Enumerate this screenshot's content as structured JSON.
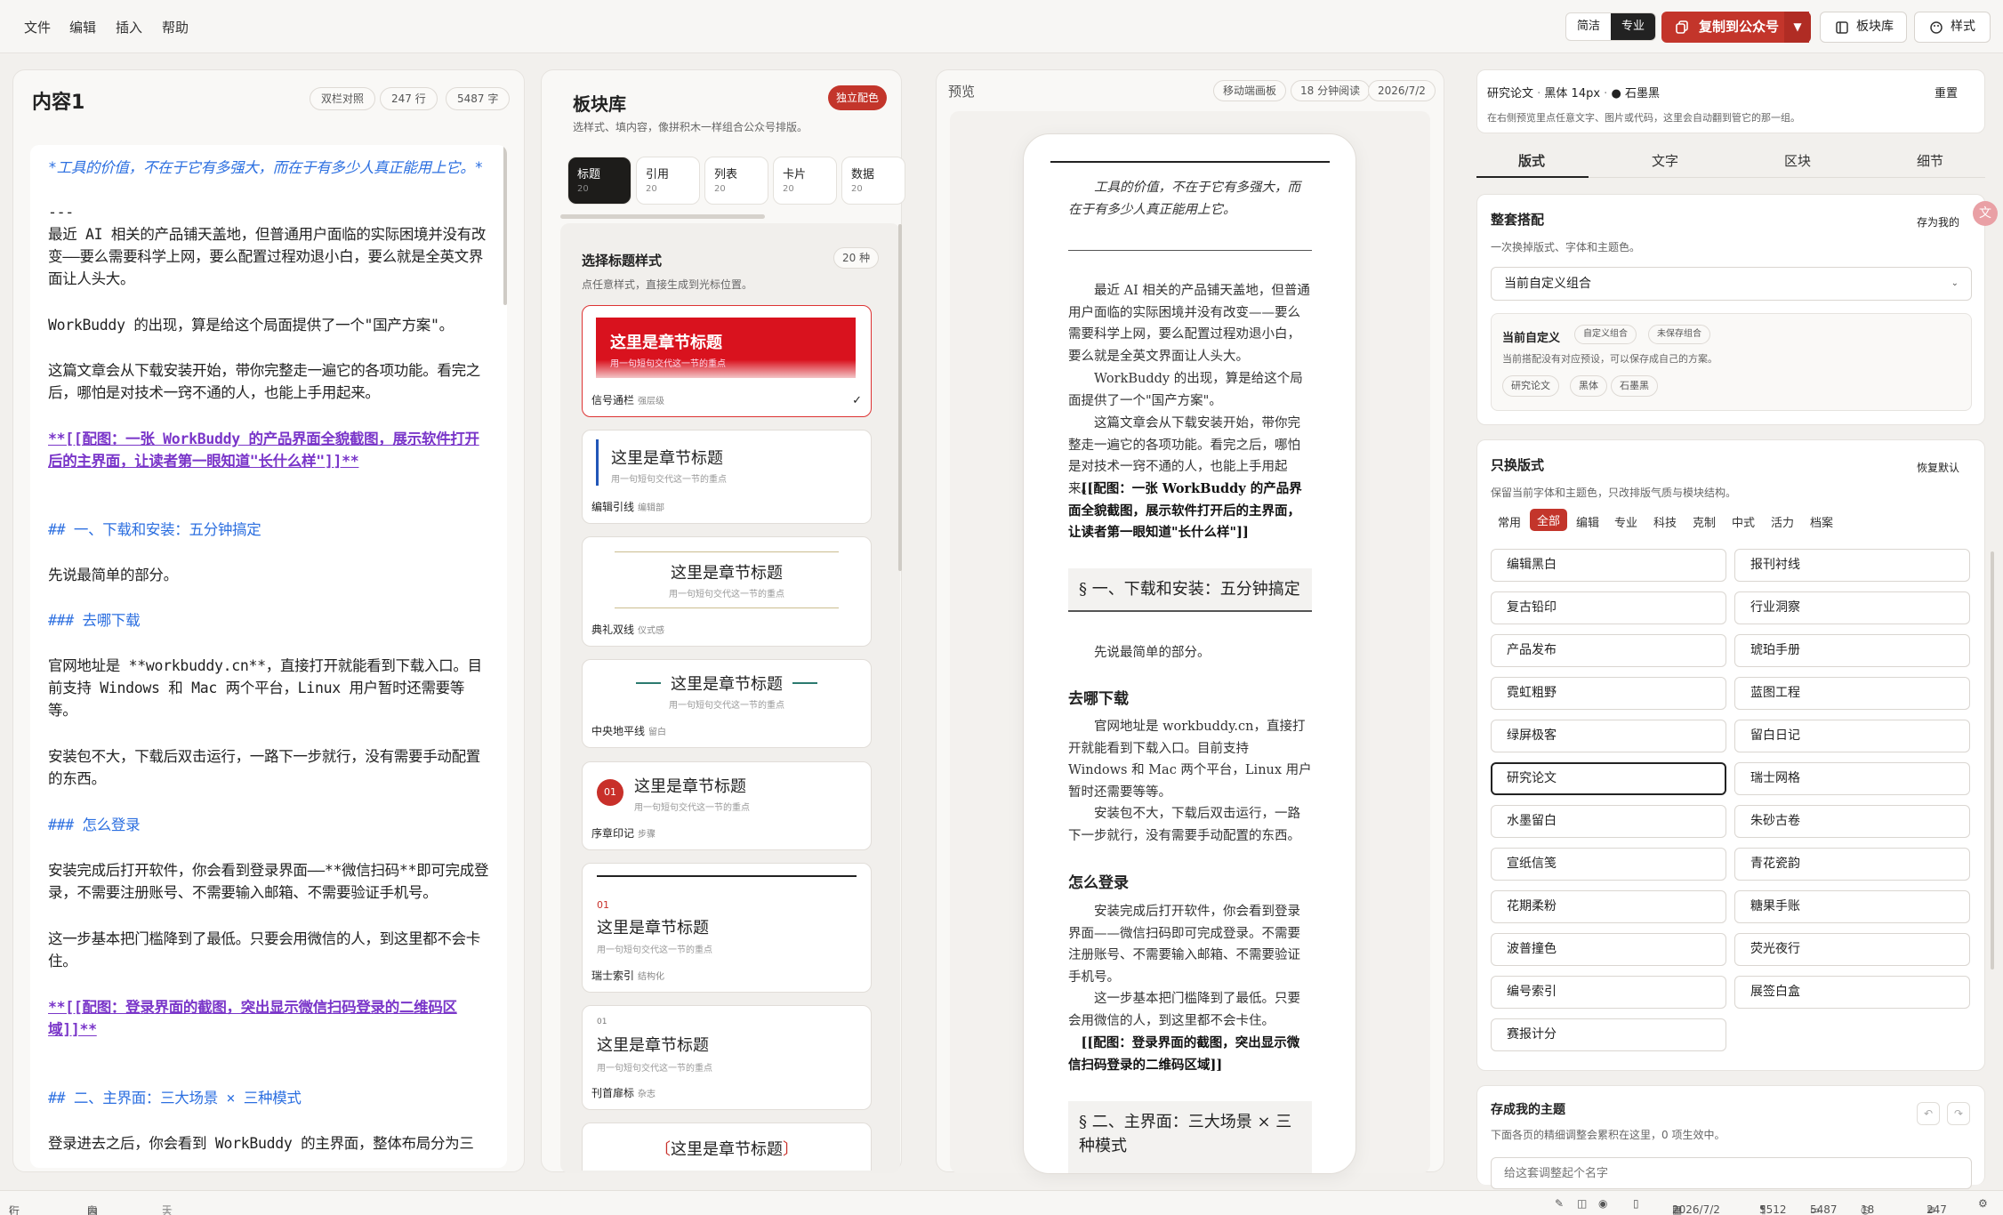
{
  "menu": [
    "文件",
    "编辑",
    "插入",
    "帮助"
  ],
  "toolbar": {
    "mode_simple": "简洁",
    "mode_pro": "专业",
    "copy_label": "复制到公众号",
    "blocks_label": "板块库",
    "style_label": "样式"
  },
  "editor": {
    "title": "内容1",
    "pill_twocol": "双栏对照",
    "pill_lines": "247 行",
    "pill_chars": "5487 字",
    "lines": [
      "*工具的价值，不在于它有多强大，而在于有多少人真正能用上它。*",
      "---",
      "最近 AI 相关的产品铺天盖地，但普通用户面临的实际困境并没有改变——要么需要科学上网，要么配置过程劝退小白，要么就是全英文界面让人头大。",
      "WorkBuddy 的出现，算是给这个局面提供了一个\"国产方案\"。",
      "这篇文章会从下载安装开始，带你完整走一遍它的各项功能。看完之后，哪怕是对技术一窍不通的人，也能上手用起来。",
      "**[[配图：一张 WorkBuddy 的产品界面全貌截图，展示软件打开后的主界面，让读者第一眼知道\"长什么样\"]]**",
      "## 一、下载和安装：五分钟搞定",
      "先说最简单的部分。",
      "### 去哪下载",
      "官网地址是 **workbuddy.cn**，直接打开就能看到下载入口。目前支持 Windows 和 Mac 两个平台，Linux 用户暂时还需要等等。",
      "安装包不大，下载后双击运行，一路下一步就行，没有需要手动配置的东西。",
      "### 怎么登录",
      "安装完成后打开软件，你会看到登录界面——**微信扫码**即可完成登录，不需要注册账号、不需要输入邮箱、不需要验证手机号。",
      "这一步基本把门槛降到了最低。只要会用微信的人，到这里都不会卡住。",
      "**[[配图：登录界面的截图，突出显示微信扫码登录的二维码区域]]**",
      "## 二、主界面：三大场景 × 三种模式",
      "登录进去之后，你会看到 WorkBuddy 的主界面，整体布局分为三"
    ]
  },
  "blocks": {
    "title": "板块库",
    "badge": "独立配色",
    "desc": "选样式、填内容，像拼积木一样组合公众号排版。",
    "tabs": [
      {
        "label": "标题",
        "count": "20"
      },
      {
        "label": "引用",
        "count": "20"
      },
      {
        "label": "列表",
        "count": "20"
      },
      {
        "label": "卡片",
        "count": "20"
      },
      {
        "label": "数据",
        "count": "20"
      }
    ],
    "section_title": "选择标题样式",
    "section_count": "20 种",
    "section_desc": "点任意样式，直接生成到光标位置。",
    "heading": "这里是章节标题",
    "sub": "用一句短句交代这一节的重点",
    "sub2": "用一句短句交代这一节的重点",
    "cards": [
      {
        "name": "信号通栏",
        "tag": "强层级"
      },
      {
        "name": "编辑引线",
        "tag": "编辑部"
      },
      {
        "name": "典礼双线",
        "tag": "仪式感"
      },
      {
        "name": "中央地平线",
        "tag": "留白"
      },
      {
        "name": "序章印记",
        "tag": "步骤"
      },
      {
        "name": "瑞士索引",
        "tag": "结构化"
      },
      {
        "name": "刊首扉标",
        "tag": "杂志"
      }
    ],
    "num01": "01",
    "num01b": "01"
  },
  "preview": {
    "title": "预览",
    "pill_device": "移动端画板",
    "pill_read": "18 分钟阅读",
    "pill_date": "2026/7/2",
    "lines": [
      "工具的价值，不在于它有多强大，而在于有多少人真正能用上它。",
      "最近 AI 相关的产品铺天盖地，但普通用户面临的实际困境并没有改变——要么需要科学上网，要么配置过程劝退小白，要么就是全英文界面让人头大。",
      "WorkBuddy 的出现，算是给这个局面提供了一个\"国产方案\"。",
      "这篇文章会从下载安装开始，带你完整走一遍它的各项功能。看完之后，哪怕是对技术一窍不通的人，也能上手用起来。",
      "[[配图：一张 WorkBuddy 的产品界面全貌截图，展示软件打开后的主界面，让读者第一眼知道\"长什么样\"]]",
      "§ 一、下载和安装：五分钟搞定",
      "先说最简单的部分。",
      "去哪下载",
      "官网地址是 workbuddy.cn，直接打开就能看到下载入口。目前支持 Windows 和 Mac 两个平台，Linux 用户暂时还需要等等。",
      "安装包不大，下载后双击运行，一路下一步就行，没有需要手动配置的东西。",
      "怎么登录",
      "安装完成后打开软件，你会看到登录界面——微信扫码即可完成登录。不需要注册账号、不需要输入邮箱、不需要验证手机号。",
      "这一步基本把门槛降到了最低。只要会用微信的人，到这里都不会卡住。",
      "[[配图：登录界面的截图，突出显示微信扫码登录的二维码区域]]",
      "§ 二、主界面：三大场景 × 三种模式"
    ]
  },
  "style": {
    "summary_a": "研究论文",
    "summary_b": "黑体 14px",
    "summary_c": "石墨黑",
    "reset": "重置",
    "hint": "在右侧预览里点任意文字、图片或代码，这里会自动翻到管它的那一组。",
    "tabs": [
      "版式",
      "文字",
      "区块",
      "细节"
    ],
    "combo_title": "整套搭配",
    "combo_save": "存为我的",
    "combo_desc": "一次换掉版式、字体和主题色。",
    "combo_select": "当前自定义组合",
    "custom_title": "当前自定义",
    "custom_tag1": "自定义组合",
    "custom_tag2": "未保存组合",
    "custom_desc": "当前搭配没有对应预设，可以保存成自己的方案。",
    "custom_chips": [
      "研究论文",
      "黑体",
      "石墨黑"
    ],
    "layout_title": "只换版式",
    "layout_restore": "恢复默认",
    "layout_desc": "保留当前字体和主题色，只改排版气质与模块结构。",
    "filters": [
      "常用",
      "全部",
      "编辑",
      "专业",
      "科技",
      "克制",
      "中式",
      "活力",
      "档案"
    ],
    "layouts": [
      "编辑黑白",
      "报刊衬线",
      "复古铅印",
      "行业洞察",
      "产品发布",
      "琥珀手册",
      "霓虹粗野",
      "蓝图工程",
      "绿屏极客",
      "留白日记",
      "研究论文",
      "瑞士网格",
      "水墨留白",
      "朱砂古卷",
      "宣纸信笺",
      "青花瓷韵",
      "花期柔粉",
      "糖果手账",
      "波普撞色",
      "荧光夜行",
      "编号索引",
      "展签白盒",
      "赛报计分"
    ],
    "save_title": "存成我的主题",
    "save_desc": "下面各页的精细调整会累积在这里，0 项生效中。",
    "save_placeholder": "给这套调整起个名字"
  },
  "status": {
    "pos": "行 1，列 1",
    "doc": "内容1",
    "outline": "大纲",
    "date": "2026/7/2",
    "n1": "3512",
    "n2": "5487",
    "read": "18 分钟",
    "lines": "247"
  },
  "colors": {
    "accent": "#c3352b",
    "purple": "#7a36c9",
    "blue": "#2c6fe0"
  }
}
